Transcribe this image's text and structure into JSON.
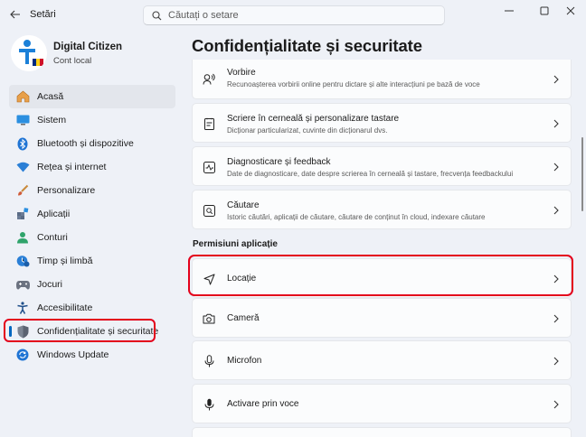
{
  "window": {
    "title": "Setări",
    "search_placeholder": "Căutați o setare"
  },
  "profile": {
    "name": "Digital Citizen",
    "account_type": "Cont local"
  },
  "sidebar": {
    "items": [
      {
        "label": "Acasă",
        "icon": "home-icon",
        "active": true
      },
      {
        "label": "Sistem",
        "icon": "system-icon"
      },
      {
        "label": "Bluetooth și dispozitive",
        "icon": "bluetooth-icon"
      },
      {
        "label": "Rețea și internet",
        "icon": "wifi-icon"
      },
      {
        "label": "Personalizare",
        "icon": "brush-icon"
      },
      {
        "label": "Aplicații",
        "icon": "apps-icon"
      },
      {
        "label": "Conturi",
        "icon": "accounts-icon"
      },
      {
        "label": "Timp și limbă",
        "icon": "time-language-icon"
      },
      {
        "label": "Jocuri",
        "icon": "gaming-icon"
      },
      {
        "label": "Accesibilitate",
        "icon": "accessibility-icon"
      },
      {
        "label": "Confidențialitate și securitate",
        "icon": "shield-icon",
        "highlighted": true
      },
      {
        "label": "Windows Update",
        "icon": "windows-update-icon"
      }
    ]
  },
  "main": {
    "title": "Confidențialitate și securitate",
    "cards_top": [
      {
        "title": "Vorbire",
        "desc": "Recunoașterea vorbirii online pentru dictare și alte interacțiuni pe bază de voce",
        "icon": "speech-icon"
      },
      {
        "title": "Scriere în cerneală și personalizare tastare",
        "desc": "Dicționar particularizat, cuvinte din dicționarul dvs.",
        "icon": "inking-icon"
      },
      {
        "title": "Diagnosticare și feedback",
        "desc": "Date de diagnosticare, date despre scrierea în cerneală și tastare, frecvența feedbackului",
        "icon": "diagnostics-icon"
      },
      {
        "title": "Căutare",
        "desc": "Istoric căutări, aplicații de căutare, căutare de conținut în cloud, indexare căutare",
        "icon": "search-permissions-icon"
      }
    ],
    "section_label": "Permisiuni aplicație",
    "cards_permissions": [
      {
        "title": "Locație",
        "icon": "location-icon",
        "highlighted": true
      },
      {
        "title": "Cameră",
        "icon": "camera-icon"
      },
      {
        "title": "Microfon",
        "icon": "microphone-icon"
      },
      {
        "title": "Activare prin voce",
        "icon": "voice-activation-icon"
      }
    ]
  },
  "colors": {
    "accent": "#0067c0",
    "highlight_box": "#e3001b",
    "background": "#eef1f7"
  }
}
